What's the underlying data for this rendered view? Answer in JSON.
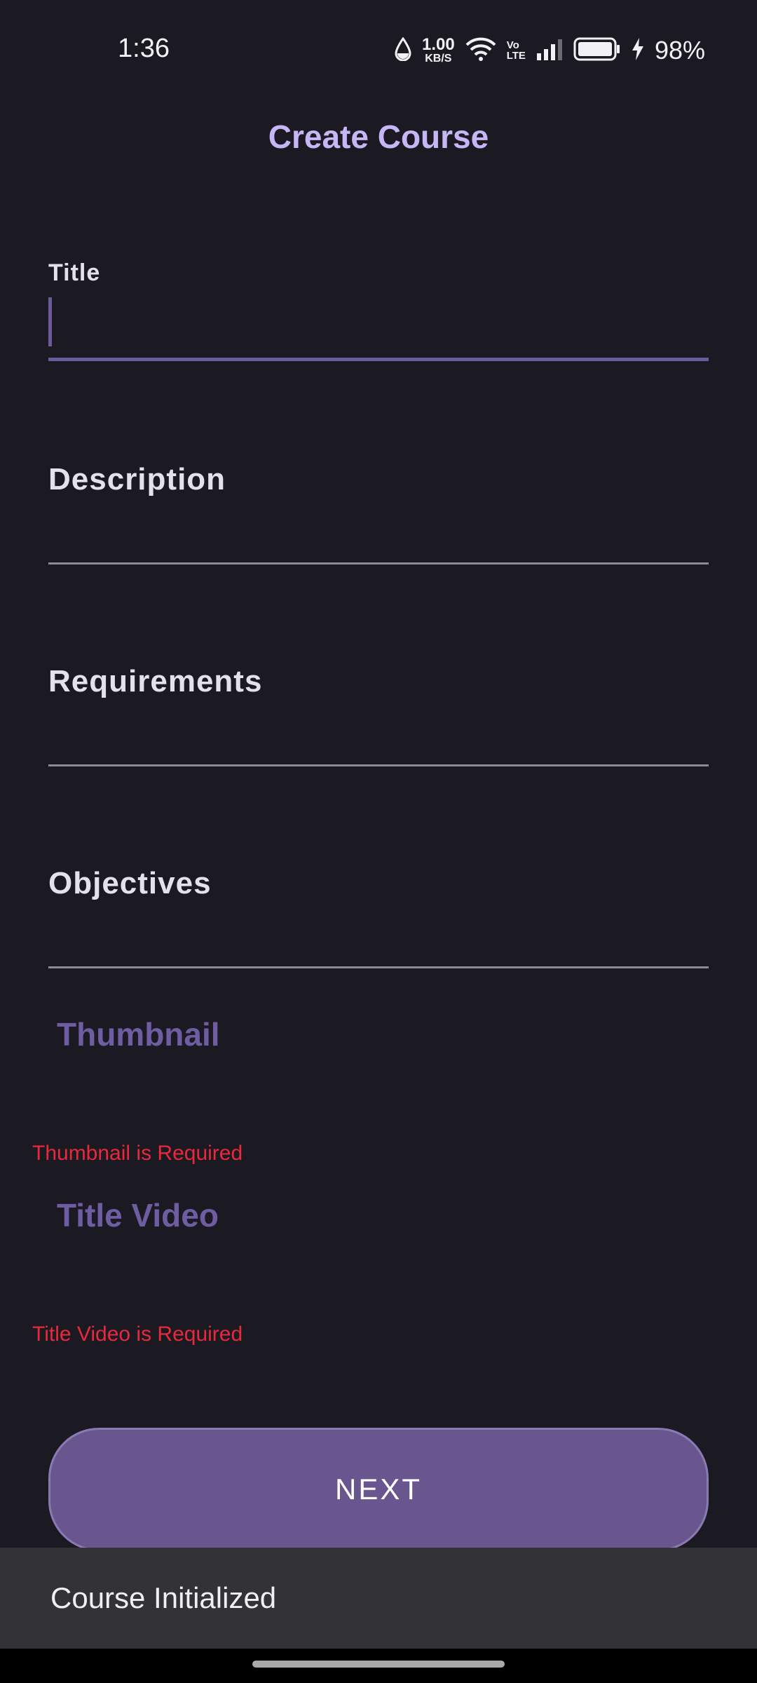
{
  "status_bar": {
    "time": "1:36",
    "net_speed_value": "1.00",
    "net_speed_unit": "KB/S",
    "volte_top": "Vo",
    "volte_bottom": "LTE",
    "battery_percent": "98%",
    "icons": [
      "drop-icon",
      "net-speed-indicator",
      "wifi-icon",
      "volte-icon",
      "signal-icon",
      "battery-icon",
      "charging-bolt-icon"
    ]
  },
  "header": {
    "title": "Create Course"
  },
  "form": {
    "title_field": {
      "label": "Title",
      "value": ""
    },
    "description_field": {
      "label": "Description",
      "value": ""
    },
    "requirements_field": {
      "label": "Requirements",
      "value": ""
    },
    "objectives_field": {
      "label": "Objectives",
      "value": ""
    },
    "thumbnail": {
      "label": "Thumbnail",
      "error": "Thumbnail is Required"
    },
    "title_video": {
      "label": "Title Video",
      "error": "Title Video is Required"
    },
    "next_label": "NEXT"
  },
  "snackbar": {
    "message": "Course Initialized"
  },
  "colors": {
    "background": "#1b1a22",
    "accent": "#6b5a9c",
    "title": "#c7b6f5",
    "error": "#e8293b",
    "button": "#69568f"
  }
}
